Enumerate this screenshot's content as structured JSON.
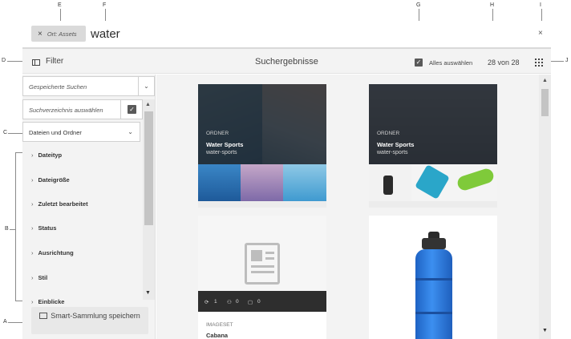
{
  "callouts": {
    "a": "A",
    "b": "B",
    "c": "C",
    "d": "D",
    "e": "E",
    "f": "F",
    "g": "G",
    "h": "H",
    "i": "I",
    "j": "J"
  },
  "search": {
    "location_tag": "Ort: Assets",
    "tag_close": "×",
    "query": "water",
    "close": "×"
  },
  "toolbar": {
    "filter_label": "Filter",
    "title": "Suchergebnisse",
    "select_all_label": "Alles auswählen",
    "select_all_checked": true,
    "count": "28 von 28"
  },
  "rail": {
    "saved_searches_placeholder": "Gespeicherte Suchen",
    "search_directory_placeholder": "Suchverzeichnis auswählen",
    "scope": "Dateien und Ordner",
    "facets": [
      "Dateityp",
      "Dateigröße",
      "Zuletzt bearbeitet",
      "Status",
      "Ausrichtung",
      "Stil",
      "Einblicke"
    ],
    "save_button": "Smart-Sammlung speichern"
  },
  "results": {
    "cards": [
      {
        "type": "ORDNER",
        "title": "Water Sports",
        "subtitle": "water-sports"
      },
      {
        "type": "ORDNER",
        "title": "Water Sports",
        "subtitle": "water-sports"
      },
      {
        "type": "IMAGESET",
        "title": "Cabana",
        "stats": [
          "1",
          "0",
          "0"
        ]
      },
      {
        "type": "",
        "title": ""
      }
    ]
  },
  "colors": {
    "overlay": "#1e2228",
    "bottle_blue": "#2f7fe0",
    "checkbox": "#595959"
  }
}
